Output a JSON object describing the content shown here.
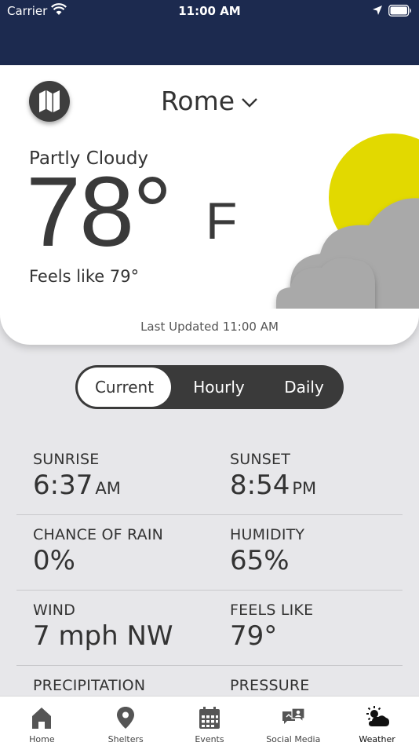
{
  "status_bar": {
    "carrier": "Carrier",
    "time": "11:00 AM",
    "icons": [
      "wifi-icon",
      "location-arrow-icon",
      "battery-icon"
    ]
  },
  "header": {
    "city": "Rome",
    "city_icon": "chevron-down-icon",
    "map_icon": "map-icon"
  },
  "current": {
    "condition": "Partly Cloudy",
    "temperature": "78°",
    "unit": "F",
    "feels_like": "Feels like 79°",
    "last_updated": "Last Updated 11:00 AM",
    "art": "partly-cloudy-icon"
  },
  "tabs": {
    "current": "Current",
    "hourly": "Hourly",
    "daily": "Daily",
    "selected": "Current"
  },
  "details": [
    {
      "left_label": "SUNRISE",
      "left_value": "6:37",
      "left_suffix": "AM",
      "right_label": "SUNSET",
      "right_value": "8:54",
      "right_suffix": "PM"
    },
    {
      "left_label": "CHANCE OF RAIN",
      "left_value": "0%",
      "left_suffix": "",
      "right_label": "HUMIDITY",
      "right_value": "65%",
      "right_suffix": ""
    },
    {
      "left_label": "WIND",
      "left_value": "7 mph NW",
      "left_suffix": "",
      "right_label": "FEELS LIKE",
      "right_value": "79°",
      "right_suffix": ""
    },
    {
      "left_label": "PRECIPITATION",
      "left_value": "",
      "left_suffix": "",
      "right_label": "PRESSURE",
      "right_value": "",
      "right_suffix": ""
    }
  ],
  "tabbar": [
    {
      "label": "Home",
      "icon": "home-icon"
    },
    {
      "label": "Shelters",
      "icon": "map-pin-icon"
    },
    {
      "label": "Events",
      "icon": "calendar-icon"
    },
    {
      "label": "Social Media",
      "icon": "social-media-icon"
    },
    {
      "label": "Weather",
      "icon": "weather-icon"
    }
  ],
  "colors": {
    "header": "#1c2a4f",
    "sun": "#e2d900",
    "cloud": "#a9a9a9",
    "control": "#3a3a3a",
    "background": "#e7e7ea"
  }
}
